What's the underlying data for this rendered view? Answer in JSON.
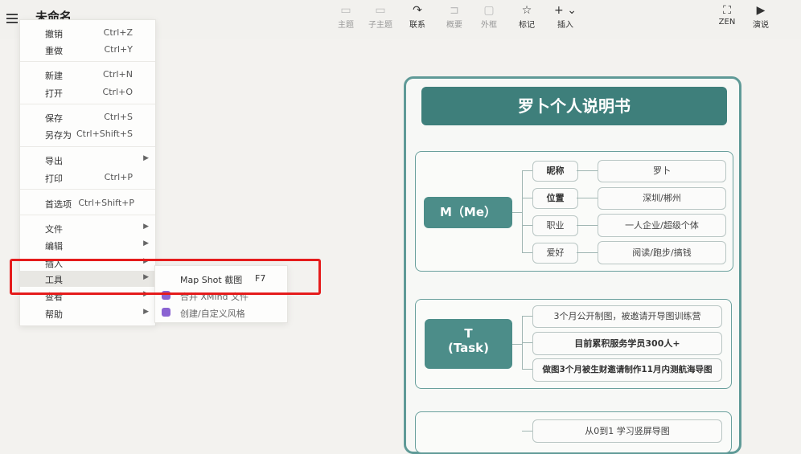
{
  "doc_title": "未命名",
  "toolbar": {
    "items": [
      {
        "label": "主题",
        "icon": "topic-icon"
      },
      {
        "label": "子主题",
        "icon": "subtopic-icon"
      },
      {
        "label": "联系",
        "icon": "relationship-icon"
      },
      {
        "label": "概要",
        "icon": "summary-icon"
      },
      {
        "label": "外框",
        "icon": "boundary-icon"
      },
      {
        "label": "标记",
        "icon": "star-icon"
      },
      {
        "label": "插入",
        "icon": "plus-icon"
      },
      {
        "label": "ZEN",
        "icon": "fullscreen-icon"
      },
      {
        "label": "演说",
        "icon": "play-icon"
      }
    ]
  },
  "menu": {
    "undo": {
      "label": "撤销",
      "shortcut": "Ctrl+Z"
    },
    "redo": {
      "label": "重做",
      "shortcut": "Ctrl+Y"
    },
    "new": {
      "label": "新建",
      "shortcut": "Ctrl+N"
    },
    "open": {
      "label": "打开",
      "shortcut": "Ctrl+O"
    },
    "save": {
      "label": "保存",
      "shortcut": "Ctrl+S"
    },
    "save_as": {
      "label": "另存为",
      "shortcut": "Ctrl+Shift+S"
    },
    "export": {
      "label": "导出"
    },
    "print": {
      "label": "打印",
      "shortcut": "Ctrl+P"
    },
    "prefs": {
      "label": "首选项",
      "shortcut": "Ctrl+Shift+P"
    },
    "file": {
      "label": "文件"
    },
    "edit": {
      "label": "编辑"
    },
    "insert": {
      "label": "插入"
    },
    "tools": {
      "label": "工具"
    },
    "view": {
      "label": "查看"
    },
    "help": {
      "label": "帮助"
    }
  },
  "submenu": {
    "map_shot": {
      "label": "Map Shot 截图",
      "shortcut": "F7"
    },
    "merge": {
      "label": "合并 XMind 文件"
    },
    "custom_style": {
      "label": "创建/自定义风格"
    }
  },
  "mindmap": {
    "title": "罗卜个人说明书",
    "me": {
      "label": "M（Me）",
      "rows": [
        {
          "key": "昵称",
          "value": "罗卜"
        },
        {
          "key": "位置",
          "value": "深圳/郴州"
        },
        {
          "key": "职业",
          "value": "一人企业/超级个体"
        },
        {
          "key": "爱好",
          "value": "阅读/跑步/搞钱"
        }
      ]
    },
    "task": {
      "label_line1": "T",
      "label_line2": "(Task)",
      "items": [
        "3个月公开制图，被邀请开导图训练营",
        "目前累积服务学员300人+",
        "做图3个月被生财邀请制作11月内测航海导图"
      ]
    },
    "third": {
      "items": [
        "从0到1 学习竖屏导图"
      ]
    }
  }
}
